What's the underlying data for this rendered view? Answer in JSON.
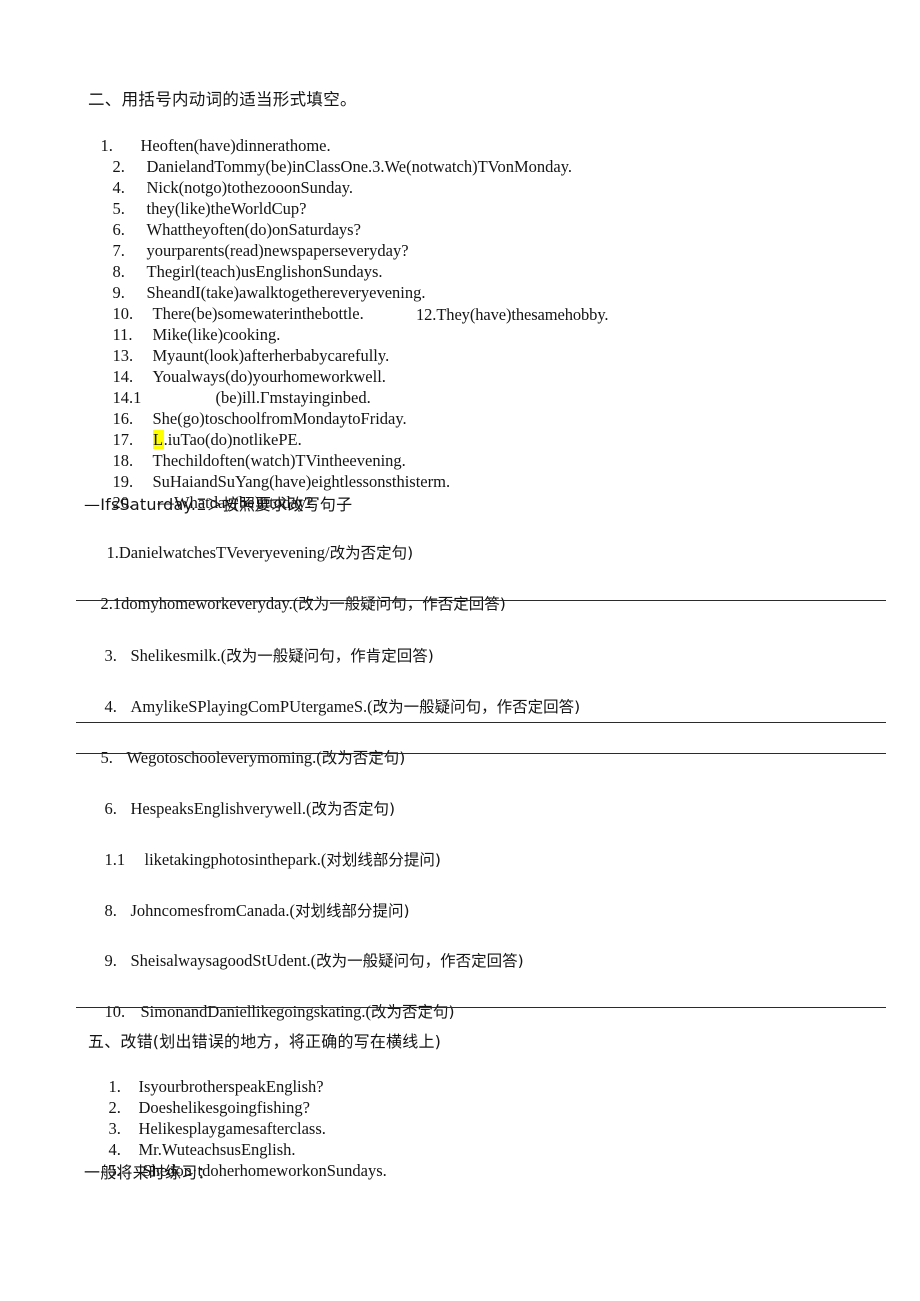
{
  "document": {
    "background_color": "#ffffff",
    "text_color": "#141414",
    "highlight_color": "#ffff00",
    "rule_color": "#2b2b2b"
  },
  "section_two": {
    "heading": "二、用括号内动词的适当形式填空。",
    "items": [
      {
        "num": "1.",
        "text": "Heoften(have)dinnerathome."
      },
      {
        "num": "2.",
        "text": "DanielandTommy(be)inClassOne.3.We(notwatch)TVonMonday."
      },
      {
        "num": "4.",
        "text": "Nick(notgo)tothezooonSunday."
      },
      {
        "num": "5.",
        "text": "they(like)theWorldCup?"
      },
      {
        "num": "6.",
        "text": "Whattheyoften(do)onSaturdays?"
      },
      {
        "num": "7.",
        "text": "yourparents(read)newspaperseveryday?"
      },
      {
        "num": "8.",
        "text": "Thegirl(teach)usEnglishonSundays."
      },
      {
        "num": "9.",
        "text": "SheandI(take)awalktogethereveryevening."
      },
      {
        "num": "10.",
        "text": "There(be)somewaterinthebottle."
      },
      {
        "num": "11.",
        "text": "Mike(like)cooking."
      },
      {
        "num": "13.",
        "text": "Myaunt(look)afterherbabycarefully."
      },
      {
        "num": "14.",
        "text": "Youalways(do)yourhomeworkwell."
      },
      {
        "num": "14.1",
        "text": "(be)ill.Γmstayinginbed."
      },
      {
        "num": "16.",
        "text": "She(go)toschoolfromMondaytoFriday."
      },
      {
        "num": "18.",
        "text": "Thechildoften(watch)TVintheevening."
      },
      {
        "num": "19.",
        "text": "SuHaiandSuYang(have)eightlessonsthisterm."
      },
      {
        "num": "20.",
        "text": "—Whatday(be)ittoday?"
      }
    ],
    "item_12_inline": "12.They(have)thesamehobby.",
    "item_17": {
      "num": "17.",
      "highlighted_char": "L",
      "rest": ".iuTao(do)notlikePE."
    }
  },
  "section_three": {
    "transition_line": "—IfsSaturday.Ξ＞按照要求改写句子",
    "items": [
      {
        "num": "1.",
        "en": "DanielwatchesTVeveryevening/",
        "zh": "改为否定句)"
      },
      {
        "num": "2.",
        "en": "1domyhomeworkeveryday.(",
        "zh": "改为一般疑问句，作否定回答)"
      },
      {
        "num": "3.",
        "en": "Shelikesmilk.(",
        "zh": "改为一般疑问句，作肯定回答)"
      },
      {
        "num": "4.",
        "en": "AmylikeSPlayingComPUtergameS.(",
        "zh": "改为一般疑问句，作否定回答)"
      },
      {
        "num": "5.",
        "en": "Wegotoschooleverymoming.(",
        "zh": "改为否定句)"
      },
      {
        "num": "6.",
        "en": "HespeaksEnglishverywell.(",
        "zh": "改为否定句)"
      },
      {
        "num": "1.1",
        "en": "liketakingphotosinthepark.(",
        "zh": "对划线部分提问)"
      },
      {
        "num": "8.",
        "en": "JohncomesfromCanada.(",
        "zh": "对划线部分提问)"
      },
      {
        "num": "9.",
        "en": "SheisalwaysagoodStUdent.(",
        "zh": "改为一般疑问句，作否定回答)"
      },
      {
        "num": "10.",
        "en": "SimonandDaniellikegoingskating.(",
        "zh": "改为否定句)"
      }
    ]
  },
  "section_five": {
    "heading": "五、改错(划出错误的地方，将正确的写在横线上)",
    "items": [
      {
        "num": "1.",
        "text": "IsyourbrotherspeakEnglish?"
      },
      {
        "num": "2.",
        "text": "Doeshelikesgoingfishing?"
      },
      {
        "num": "3.",
        "text": "Helikesplaygamesafterclass."
      },
      {
        "num": "4.",
        "text": "Mr.WuteachsusEnglish."
      },
      {
        "num": "5.",
        "text": "Shedon·tdoherhomeworkonSundays."
      }
    ]
  },
  "footer": {
    "text": "一般将来时练习："
  }
}
